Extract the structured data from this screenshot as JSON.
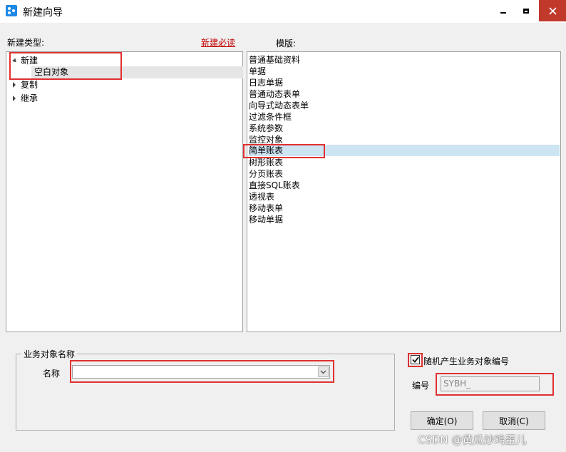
{
  "window": {
    "title": "新建向导"
  },
  "labels": {
    "type": "新建类型:",
    "must_read": "新建必读",
    "template": "模版:"
  },
  "tree": {
    "new": "新建",
    "blank_object": "空白对象",
    "copy": "复制",
    "inherit": "继承"
  },
  "templates": [
    "普通基础资料",
    "单据",
    "日志单据",
    "普通动态表单",
    "向导式动态表单",
    "过滤条件框",
    "系统参数",
    "监控对象",
    "简单账表",
    "树形账表",
    "分页账表",
    "直接SQL账表",
    "透视表",
    "移动表单",
    "移动单据"
  ],
  "selected_template": "简单账表",
  "business": {
    "group_title": "业务对象名称",
    "name_label": "名称",
    "name_value": ""
  },
  "random_code": {
    "label": "随机产生业务对象编号",
    "checked": true
  },
  "code": {
    "label": "编号",
    "value": "SYBH_"
  },
  "buttons": {
    "ok": "确定(O)",
    "cancel": "取消(C)"
  },
  "watermark": "CSDN @黄瓜炒鸡蛋儿",
  "colors": {
    "highlight": "#e03030",
    "selection": "#cde4f2",
    "link": "#c00000",
    "close": "#c0392b"
  }
}
